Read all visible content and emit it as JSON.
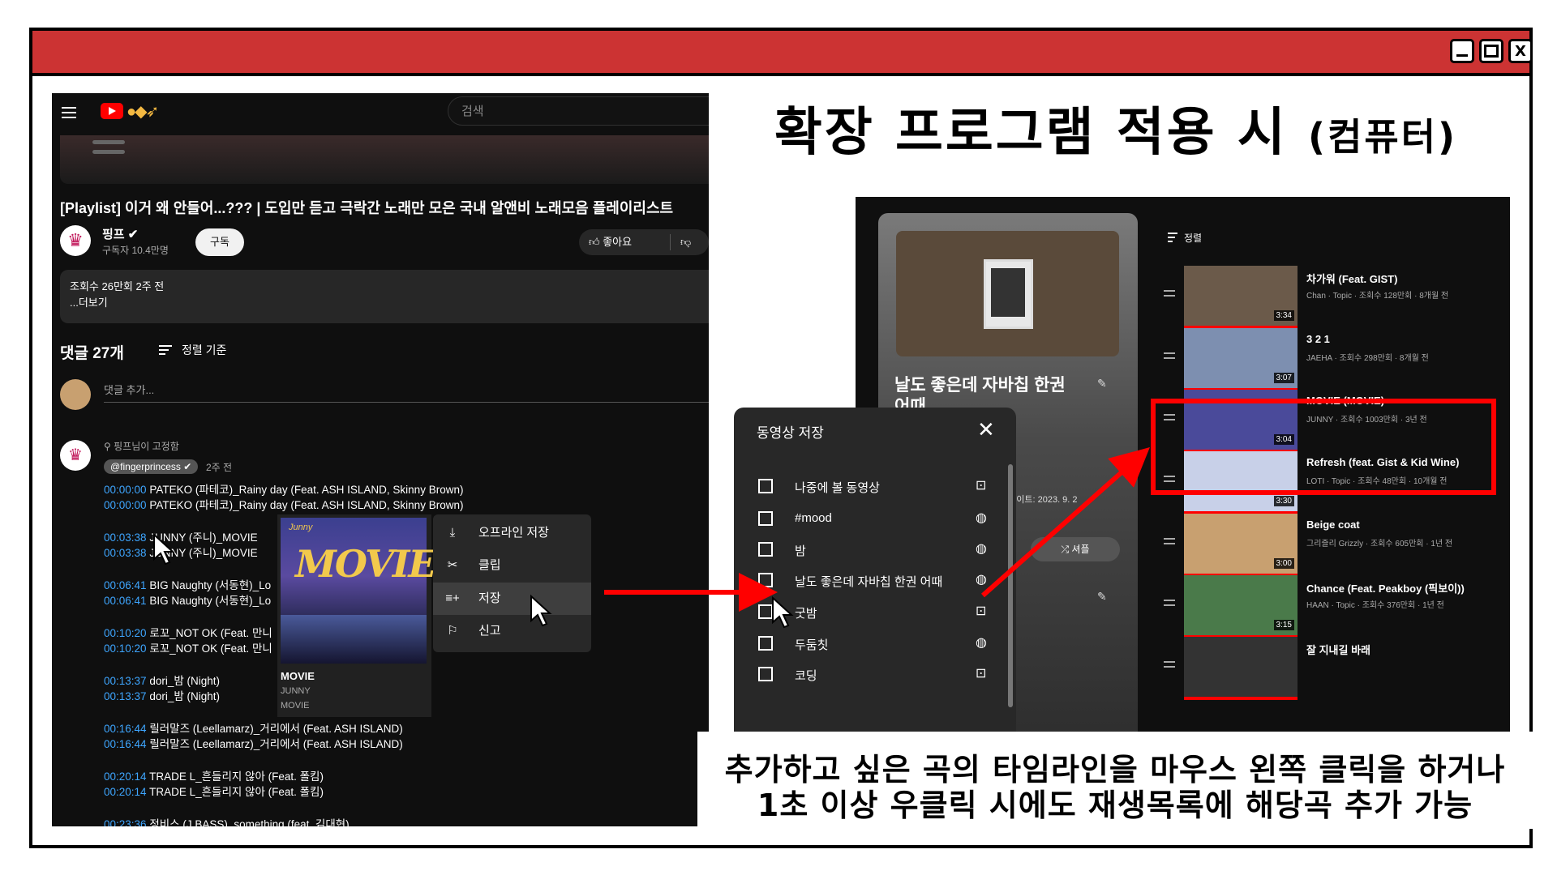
{
  "window": {
    "controls": [
      "_",
      "□",
      "X"
    ]
  },
  "heading": {
    "main": "확장 프로그램 적용 시",
    "sub": "(컴퓨터)"
  },
  "youtube": {
    "search_placeholder": "검색",
    "video_title": "[Playlist] 이거 왜 안들어...??? | 도입만 듣고 극락간 노래만 모은 국내 알앤비 노래모음 플레이리스트",
    "channel_name": "핑프 ✔",
    "subscribers": "구독자 10.4만명",
    "subscribe_label": "구독",
    "like_label": "좋아요",
    "views_line": "조회수 26만회 2주 전",
    "more_label": "...더보기",
    "comment_count": "댓글 27개",
    "sort_label": "정렬 기준",
    "add_comment_placeholder": "댓글 추가...",
    "pinned_label": "핑프님이 고정함",
    "handle": "@fingerprincess ✔",
    "comment_ago": "2주 전",
    "timestamps": [
      {
        "time": "00:00:00",
        "text": "PATEKO (파테코)_Rainy day (Feat. ASH ISLAND, Skinny Brown)"
      },
      {
        "time": "00:00:00",
        "text": "PATEKO (파테코)_Rainy day (Feat. ASH ISLAND, Skinny Brown)"
      },
      {
        "time": "00:03:38",
        "text": "JUNNY (주니)_MOVIE"
      },
      {
        "time": "00:03:38",
        "text": "JUNNY (주니)_MOVIE"
      },
      {
        "time": "00:06:41",
        "text": "BIG Naughty (서동현)_Lo"
      },
      {
        "time": "00:06:41",
        "text": "BIG Naughty (서동현)_Lo"
      },
      {
        "time": "00:10:20",
        "text": "로꼬_NOT OK (Feat. 만니"
      },
      {
        "time": "00:10:20",
        "text": "로꼬_NOT OK (Feat. 만니"
      },
      {
        "time": "00:13:37",
        "text": "dori_밤 (Night)"
      },
      {
        "time": "00:13:37",
        "text": "dori_밤 (Night)"
      },
      {
        "time": "00:16:44",
        "text": "릴러말즈 (Leellamarz)_거리에서 (Feat. ASH ISLAND)"
      },
      {
        "time": "00:16:44",
        "text": "릴러말즈 (Leellamarz)_거리에서 (Feat. ASH ISLAND)"
      },
      {
        "time": "00:20:14",
        "text": "TRADE L_흔들리지 않아 (Feat. 폴킴)"
      },
      {
        "time": "00:20:14",
        "text": "TRADE L_흔들리지 않아 (Feat. 폴킴)"
      },
      {
        "time": "00:23:36",
        "text": "정비스 (J BASS)_something (feat. 김대현)"
      }
    ],
    "thumb_card": {
      "brand": "Junny",
      "album_word": "MOVIE",
      "title": "MOVIE",
      "artist": "JUNNY",
      "album": "MOVIE"
    },
    "context_menu": [
      {
        "icon": "download-icon",
        "glyph": "⤓",
        "label": "오프라인 저장"
      },
      {
        "icon": "scissors-icon",
        "glyph": "✂",
        "label": "클립"
      },
      {
        "icon": "playlist-add-icon",
        "glyph": "≡+",
        "label": "저장"
      },
      {
        "icon": "flag-icon",
        "glyph": "⚐",
        "label": "신고"
      }
    ]
  },
  "playlist_panel": {
    "title_line1": "날도 좋은데 자바칩 한권",
    "title_line2": "어때",
    "updated": "업데이트: 2023. 9. 2",
    "shuffle_label": "셔플",
    "sort_label": "정렬",
    "items": [
      {
        "title": "차가워 (Feat. GIST)",
        "meta": "Chan · Topic · 조회수 128만회 · 8개월 전",
        "duration": "3:34",
        "color": "#6b5a4a"
      },
      {
        "title": "3 2 1",
        "meta": "JAEHA · 조회수 298만회 · 8개월 전",
        "duration": "3:07",
        "color": "#7d8fb0"
      },
      {
        "title": "MOVIE (MOVIE)",
        "meta": "JUNNY · 조회수 1003만회 · 3년 전",
        "duration": "3:04",
        "color": "#4a4a9a"
      },
      {
        "title": "Refresh (feat. Gist & Kid Wine)",
        "meta": "LOTI · Topic · 조회수 48만회 · 10개월 전",
        "duration": "3:30",
        "color": "#c8d0e8"
      },
      {
        "title": "Beige coat",
        "meta": "그리즐리 Grizzly · 조회수 605만회 · 1년 전",
        "duration": "3:00",
        "color": "#c8a070"
      },
      {
        "title": "Chance (Feat. Peakboy (픽보이))",
        "meta": "HAAN · Topic · 조회수 376만회 · 1년 전",
        "duration": "3:15",
        "color": "#4a7a4a"
      },
      {
        "title": "잘 지내길 바래",
        "meta": "",
        "duration": "",
        "color": "#333333"
      }
    ]
  },
  "save_dialog": {
    "header": "동영상 저장",
    "options": [
      {
        "label": "나중에 볼 동영상",
        "icon": "lock-icon",
        "glyph": "🔒︎"
      },
      {
        "label": "#mood",
        "icon": "globe-icon",
        "glyph": "◍"
      },
      {
        "label": "밤",
        "icon": "globe-icon",
        "glyph": "◍"
      },
      {
        "label": "날도 좋은데 자바칩 한권 어때",
        "icon": "globe-icon",
        "glyph": "◍"
      },
      {
        "label": "굿밤",
        "icon": "lock-icon",
        "glyph": "🔒︎"
      },
      {
        "label": "두둠칫",
        "icon": "globe-icon",
        "glyph": "◍"
      },
      {
        "label": "코딩",
        "icon": "lock-icon",
        "glyph": "🔒︎"
      }
    ]
  },
  "caption": {
    "line1": "추가하고 싶은 곡의 타임라인을 마우스 왼쪽 클릭을 하거나",
    "line2": "1초 이상 우클릭 시에도 재생목록에 해당곡 추가 가능"
  },
  "colors": {
    "titlebar": "#cc3333",
    "arrow": "#ff0000",
    "link": "#3ea6ff"
  }
}
